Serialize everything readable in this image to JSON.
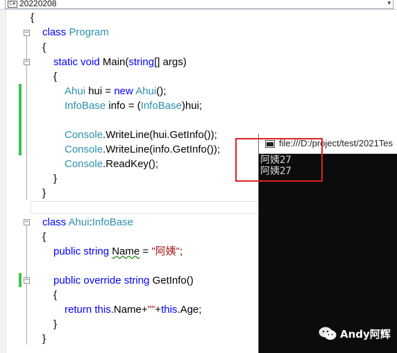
{
  "nav_dropdown": {
    "icon": "csharp-file-icon",
    "icon_text": "C#",
    "value": "20220208",
    "arrow": "▾"
  },
  "code": {
    "l_open_ns": "{",
    "l_class_program": {
      "kw": "class",
      "name": "Program"
    },
    "l_open1": "{",
    "l_main": {
      "kw": "static void",
      "name": "Main(",
      "ty": "string",
      "rest": "[] args)"
    },
    "l_open2": "{",
    "l_hui": {
      "ty1": "Ahui",
      "mid": " hui = ",
      "kw": "new",
      "ty2": "Ahui",
      "end": "();"
    },
    "l_info": {
      "ty1": "InfoBase",
      "mid": " info = (",
      "ty2": "InfoBase",
      "end": ")hui;"
    },
    "l_write1": {
      "ty": "Console",
      "rest": ".WriteLine(hui.GetInfo());"
    },
    "l_write2": {
      "ty": "Console",
      "rest": ".WriteLine(info.GetInfo());"
    },
    "l_read": {
      "ty": "Console",
      "rest": ".ReadKey();"
    },
    "l_close2": "}",
    "l_close1": "}",
    "l_class_ahui": {
      "kw": "class",
      "ty1": "Ahui",
      "colon": ":",
      "ty2": "InfoBase"
    },
    "l_open3": "{",
    "l_name": {
      "kw": "public string",
      "name": "Name",
      "mid": " = ",
      "str": "\"阿姨\"",
      "end": ";"
    },
    "l_getinfo": {
      "kw": "public override string",
      "rest": " GetInfo()"
    },
    "l_open4": "{",
    "l_return": {
      "kw1": "return",
      "sp": " ",
      "kw2": "this",
      "mid": ".Name+",
      "str": "\"\"",
      "plus": "+",
      "kw3": "this",
      "end": ".Age;"
    },
    "l_close4": "}",
    "l_close3": "}"
  },
  "console": {
    "title": "file:///D:/project/test/2021Tes",
    "output": [
      "阿姨27",
      "阿姨27"
    ]
  },
  "watermark": {
    "text": "Andy阿辉",
    "icon": "wechat-icon"
  },
  "colors": {
    "keyword": "#0000ff",
    "type": "#2b91af",
    "string": "#a31515",
    "change_marker": "#3cc34a",
    "highlight": "#e02020",
    "console_bg": "#0c0c0c"
  }
}
